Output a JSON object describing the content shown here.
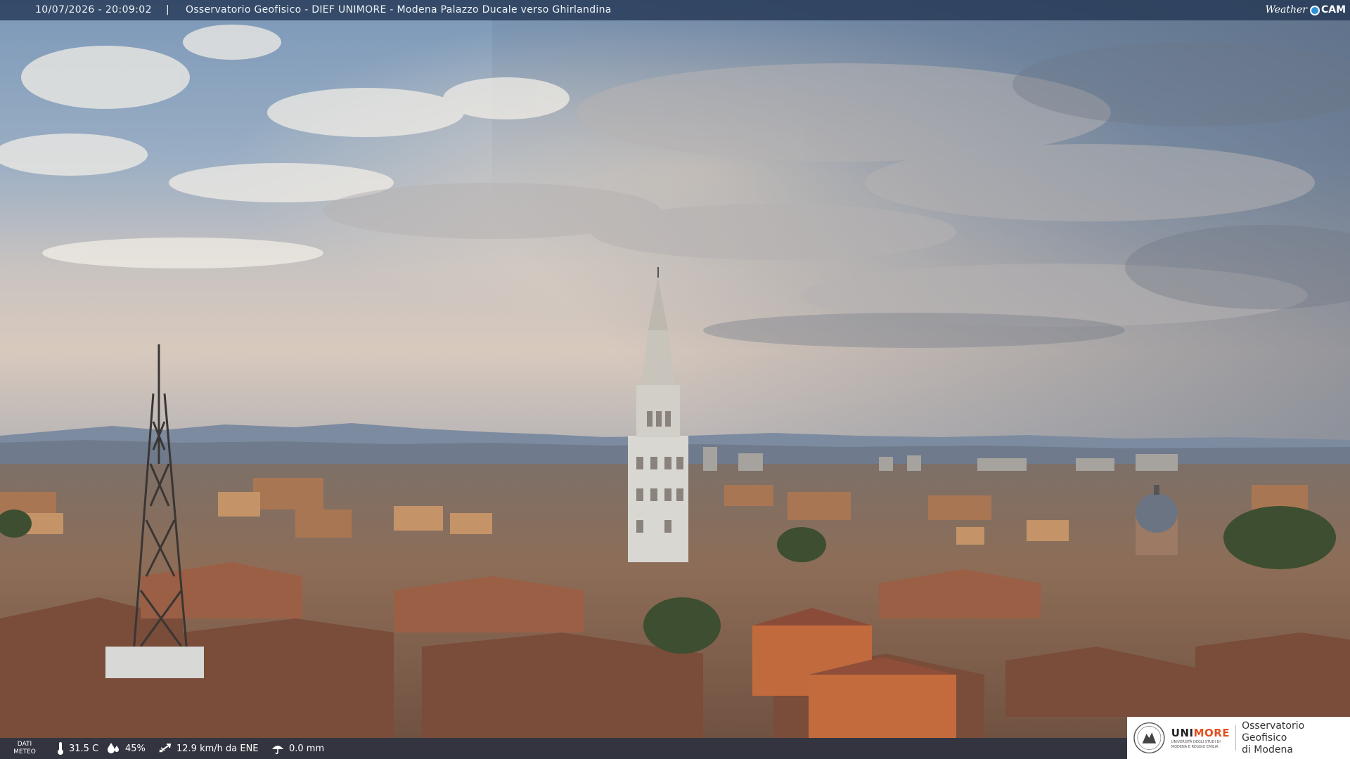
{
  "header": {
    "datetime": "10/07/2026 - 20:09:02",
    "separator": "|",
    "title": "Osservatorio Geofisico - DIEF UNIMORE - Modena Palazzo Ducale verso Ghirlandina",
    "brand_weather": "Weather",
    "brand_cam": "CAM"
  },
  "weather": {
    "label_line1": "DATI",
    "label_line2": "METEO",
    "temperature": "31.5 C",
    "humidity": "45%",
    "wind": "12.9 km/h da ENE",
    "rain": "0.0 mm",
    "icons": [
      "thermometer-icon",
      "humidity-drop-icon",
      "wind-icon",
      "rain-icon"
    ]
  },
  "logo": {
    "uni_prefix": "UNI",
    "uni_suffix": "MORE",
    "uni_subtitle_1": "UNIVERSITÀ DEGLI STUDI DI",
    "uni_subtitle_2": "MODENA E REGGIO EMILIA",
    "observatory_line1": "Osservatorio Geofisico",
    "observatory_line2": "di Modena"
  },
  "colors": {
    "header_bar": "#213452",
    "accent_orange": "#e0501f",
    "brand_blue": "#2f8fd8"
  }
}
